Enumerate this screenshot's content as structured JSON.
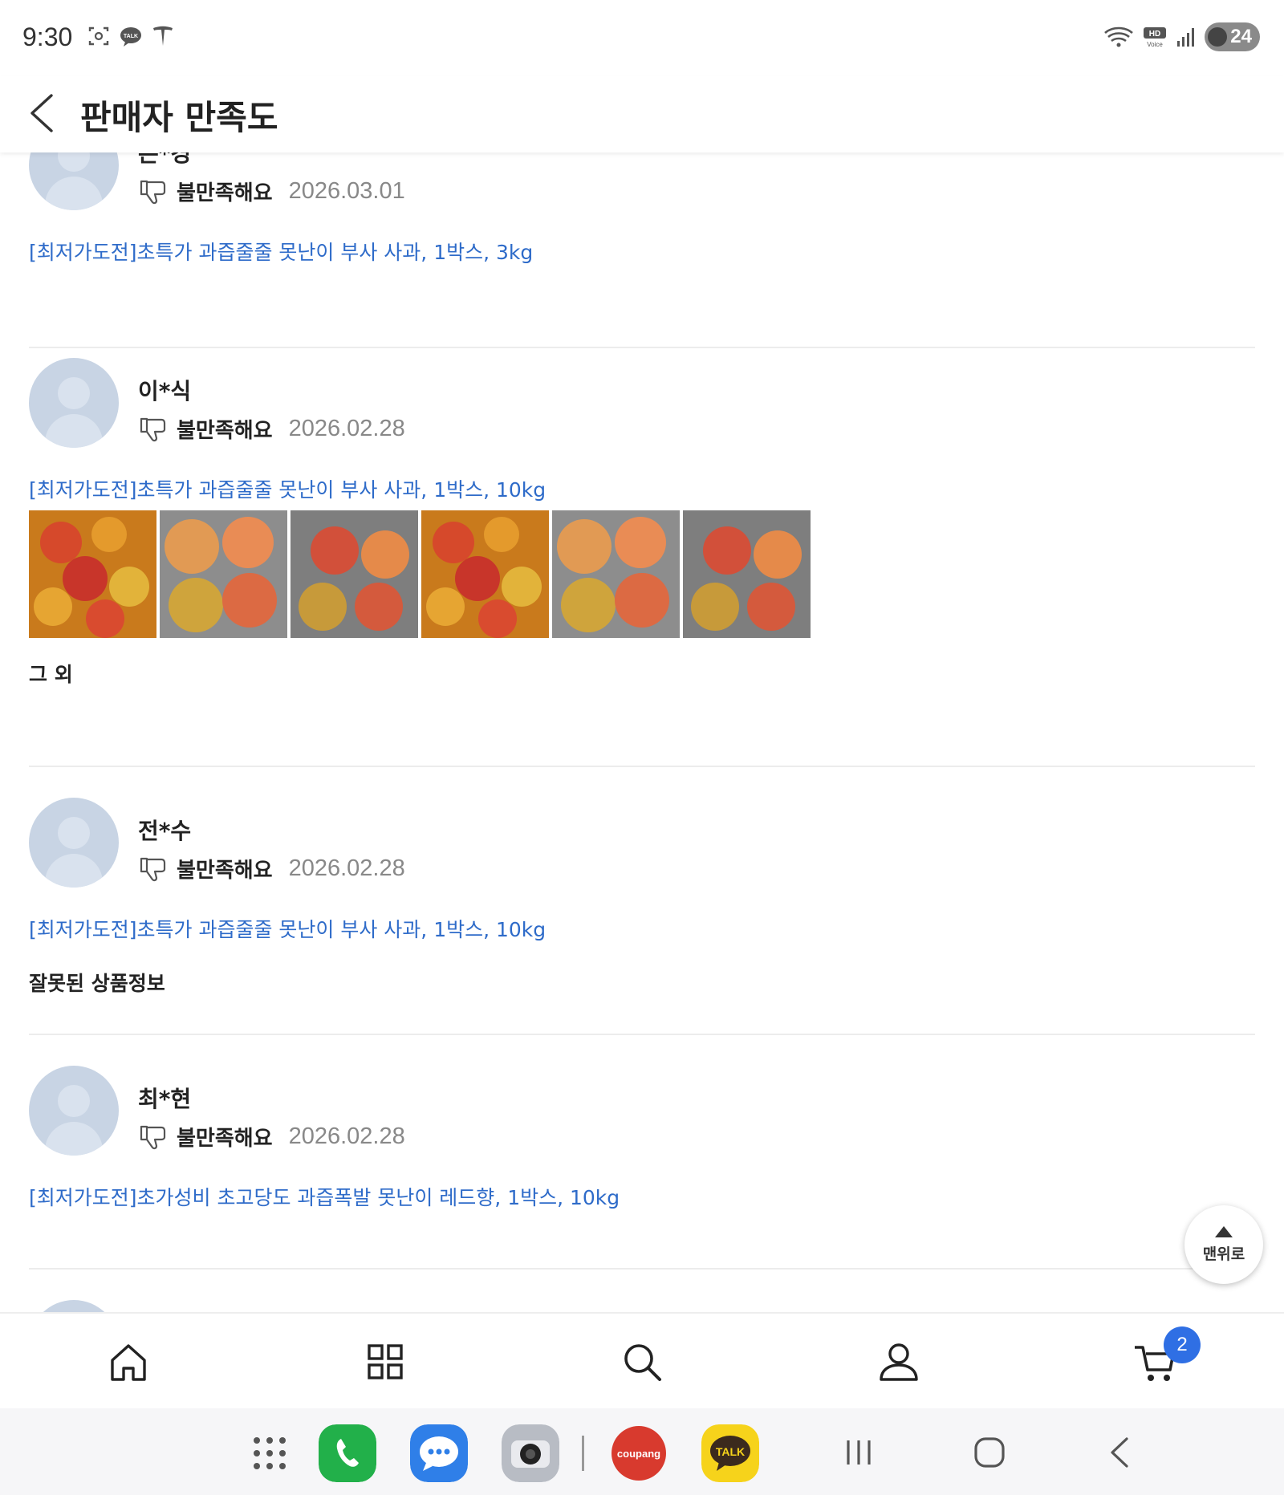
{
  "status_bar": {
    "time": "9:30",
    "battery": "24",
    "icons_left": [
      "screenshot-icon",
      "kakaotalk-notification-icon",
      "tesla-icon"
    ],
    "icons_right": [
      "wifi-icon",
      "hd-voice-icon",
      "signal-icon",
      "battery-icon"
    ]
  },
  "header": {
    "title": "판매자 만족도"
  },
  "reviews": [
    {
      "name": "은*경",
      "rating": "불만족해요",
      "date": "2026.03.01",
      "product": "[최저가도전]초특가 과즙줄줄 못난이 부사 사과, 1박스, 3kg",
      "body": ""
    },
    {
      "name": "이*식",
      "rating": "불만족해요",
      "date": "2026.02.28",
      "product": "[최저가도전]초특가 과즙줄줄 못난이 부사 사과, 1박스, 10kg",
      "photo_count": 6,
      "body": "그 외"
    },
    {
      "name": "전*수",
      "rating": "불만족해요",
      "date": "2026.02.28",
      "product": "[최저가도전]초특가 과즙줄줄 못난이 부사 사과, 1박스, 10kg",
      "body": "잘못된 상품정보"
    },
    {
      "name": "최*현",
      "rating": "불만족해요",
      "date": "2026.02.28",
      "product": "[최저가도전]초가성비 초고당도 과즙폭발 못난이 레드향, 1박스, 10kg",
      "body": ""
    }
  ],
  "top_button": {
    "label": "맨위로"
  },
  "bottom_nav": {
    "items": [
      "home-icon",
      "category-icon",
      "search-icon",
      "my-page-icon",
      "cart-icon"
    ],
    "cart_count": "2"
  },
  "dock": {
    "apps": [
      "app-drawer-icon",
      "phone-app-icon",
      "messages-app-icon",
      "camera-app-icon",
      "coupang-app-icon",
      "kakaotalk-app-icon"
    ],
    "coupang_label": "coupang",
    "talk_label": "TALK"
  },
  "colors": {
    "link": "#2e6bc9",
    "avatar": "#c8d4e4",
    "badge": "#2f6fe4",
    "date": "#888888"
  }
}
